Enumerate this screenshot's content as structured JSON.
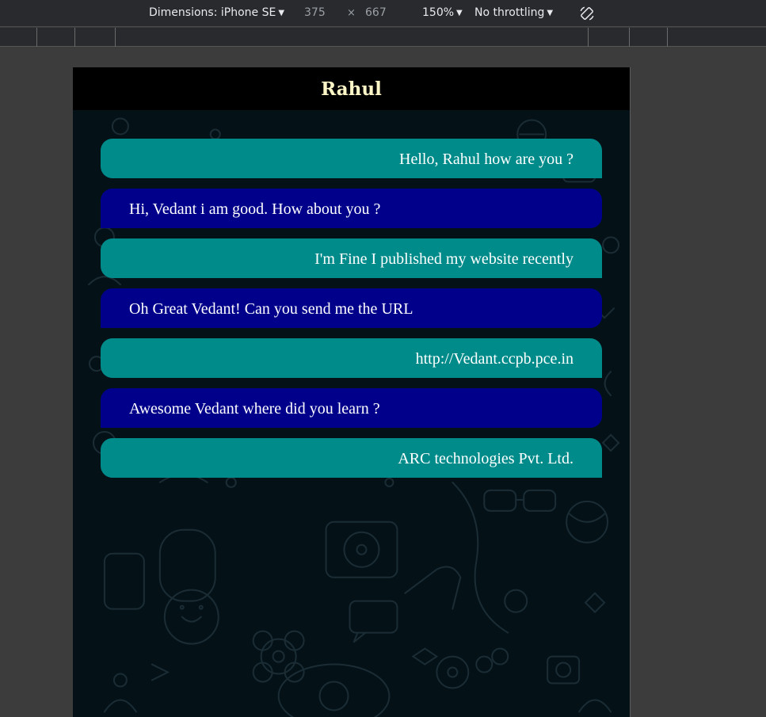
{
  "devtools": {
    "dimensions_label": "Dimensions: iPhone SE",
    "width": "375",
    "times": "×",
    "height": "667",
    "zoom": "150%",
    "throttling": "No throttling",
    "rotate_icon": "rotate-icon"
  },
  "chat": {
    "contact_name": "Rahul",
    "messages": [
      {
        "type": "sent",
        "text": "Hello, Rahul how are you ?"
      },
      {
        "type": "received",
        "text": "Hi, Vedant i am good. How about you ?"
      },
      {
        "type": "sent",
        "text": "I'm Fine I published my website recently"
      },
      {
        "type": "received",
        "text": "Oh Great Vedant! Can you send me the URL"
      },
      {
        "type": "sent",
        "text": "http://Vedant.ccpb.pce.in"
      },
      {
        "type": "received",
        "text": "Awesome Vedant where did you learn ?"
      },
      {
        "type": "sent",
        "text": "ARC technologies Pvt. Ltd."
      }
    ],
    "colors": {
      "sent": "#008b8b",
      "received": "#00008b",
      "header": "#000000",
      "title": "#fff7c7",
      "background": "#041218"
    }
  }
}
